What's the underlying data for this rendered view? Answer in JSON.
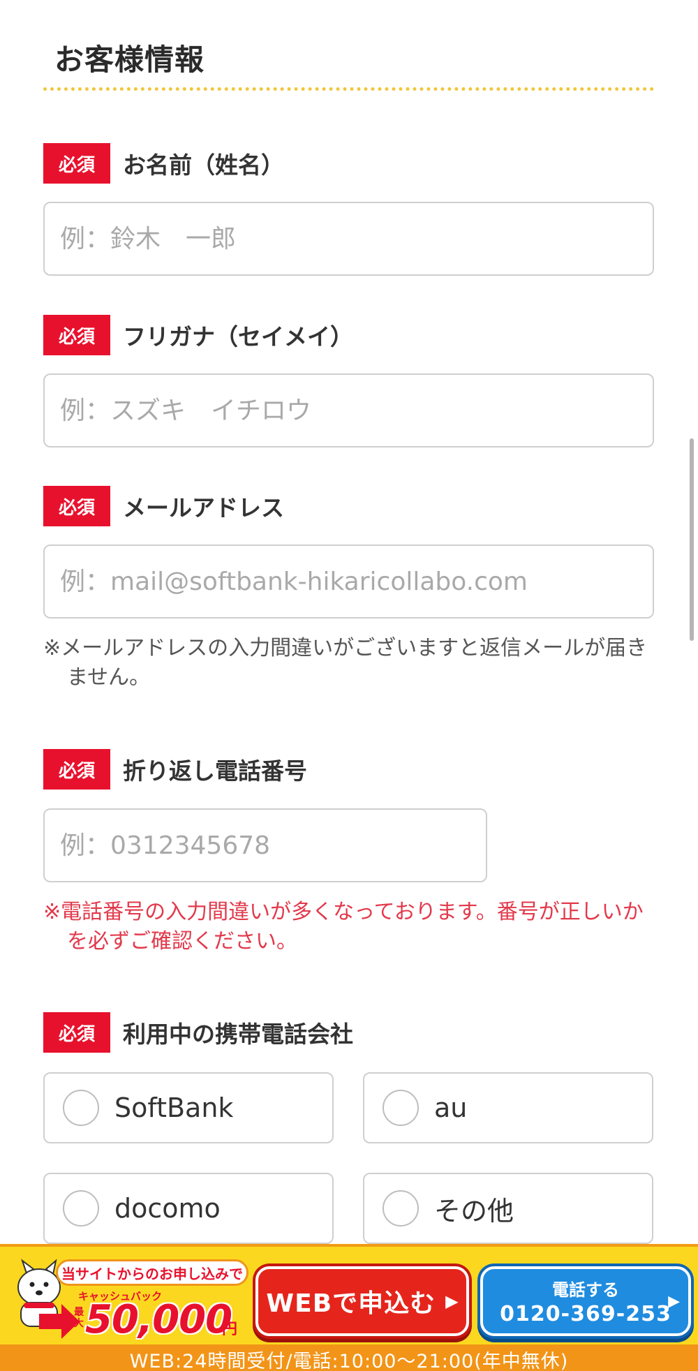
{
  "section": {
    "title": "お客様情報"
  },
  "required_badge": "必須",
  "fields": {
    "name": {
      "label": "お名前（姓名）",
      "placeholder": "例：鈴木　一郎",
      "value": ""
    },
    "kana": {
      "label": "フリガナ（セイメイ）",
      "placeholder": "例：スズキ　イチロウ",
      "value": ""
    },
    "email": {
      "label": "メールアドレス",
      "placeholder": "例：mail@softbank-hikaricollabo.com",
      "value": "",
      "note": "※メールアドレスの入力間違いがございますと返信メールが届きません。"
    },
    "phone": {
      "label": "折り返し電話番号",
      "placeholder": "例：0312345678",
      "value": "",
      "note": "※電話番号の入力間違いが多くなっております。番号が正しいかを必ずご確認ください。"
    },
    "carrier": {
      "label": "利用中の携帯電話会社",
      "options": [
        "SoftBank",
        "au",
        "docomo",
        "その他"
      ],
      "selected": null
    }
  },
  "cta": {
    "promo_lead": "当サイトからのお申し込みで",
    "cashback": "キャッシュバック",
    "max_label": "最大",
    "amount": "50,000",
    "yen": "円",
    "web_button": "WEBで申込む",
    "call_label": "電話する",
    "phone_number": "0120-369-253",
    "hours": "WEB:24時間受付/電話:10:00～21:00(年中無休)"
  },
  "colors": {
    "required": "#e8112d",
    "accent_dotted": "#f0c63a",
    "cta_bg": "#fbd81f",
    "cta_strip": "#f29418",
    "web_button": "#e5251c",
    "tel_button": "#1f8ce0",
    "warning_text": "#e2394b"
  }
}
